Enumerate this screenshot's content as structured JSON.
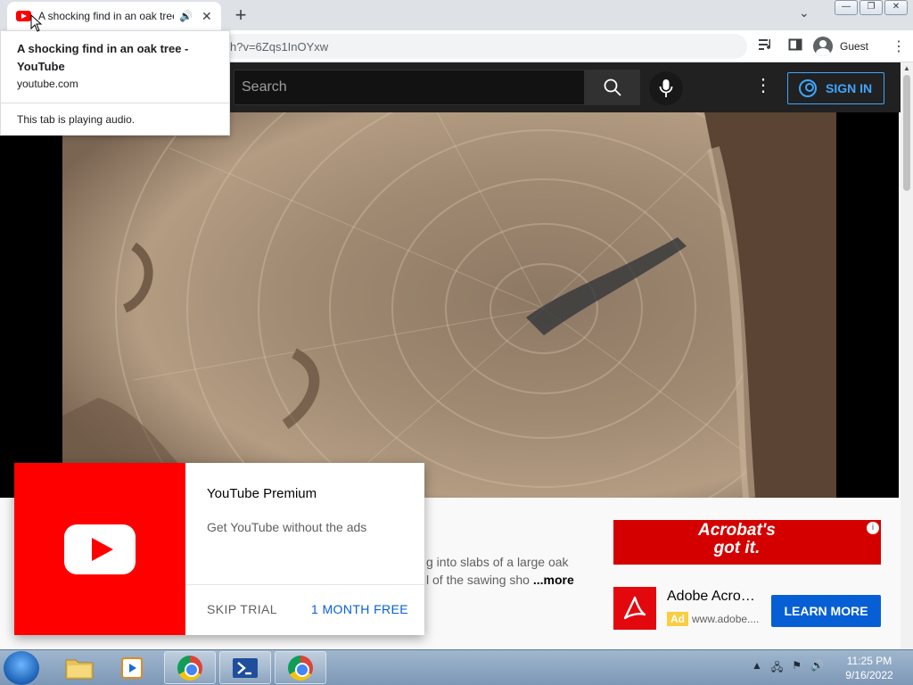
{
  "browser": {
    "tab_title": "A shocking find in an oak tree - YouTube",
    "new_tab": "+",
    "tab_search": "⌄",
    "tab_close": "✕",
    "speaker": "🔊",
    "url": "h?v=6Zqs1InOYxw",
    "profile": "Guest",
    "window_buttons": [
      "—",
      "❐",
      "✕"
    ]
  },
  "hover_card": {
    "title": "A shocking find in an oak tree - YouTube",
    "domain": "youtube.com",
    "audio": "This tab is playing audio."
  },
  "youtube": {
    "search_placeholder": "Search",
    "sign_in": "SIGN IN",
    "description_line1": "g into slabs of a large oak",
    "description_line2": "l of the sawing sho",
    "more": "...more"
  },
  "ad": {
    "banner_line1": "Acrobat's",
    "banner_line2": "got it.",
    "info": "i",
    "title": "Adobe Acrob...",
    "badge": "Ad",
    "url": "www.adobe....",
    "cta": "LEARN MORE"
  },
  "promo": {
    "title": "YouTube Premium",
    "subtitle": "Get YouTube without the ads",
    "skip": "SKIP TRIAL",
    "free": "1 MONTH FREE"
  },
  "taskbar": {
    "time": "11:25 PM",
    "date": "9/16/2022"
  },
  "colors": {
    "youtube_red": "#ff0000",
    "link_blue": "#065fd4",
    "signin_blue": "#3ea6ff"
  }
}
